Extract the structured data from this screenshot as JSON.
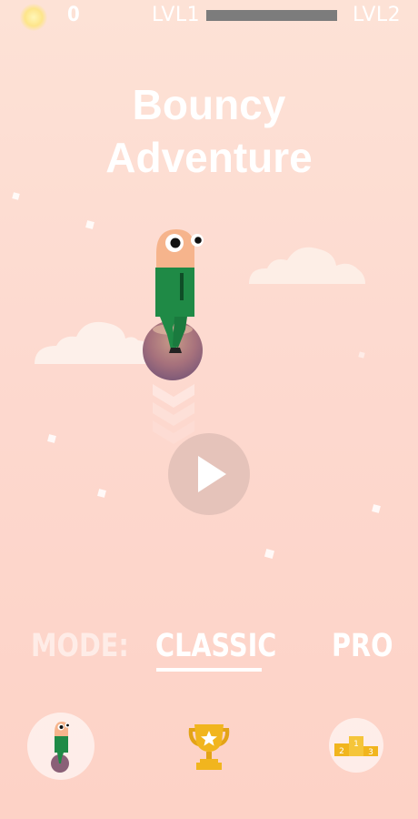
{
  "hud": {
    "score": "0",
    "level_from": "LVL1",
    "level_to": "LVL2",
    "level_progress": 0.0,
    "sun_icon": "sun-icon"
  },
  "title": {
    "line1": "Bouncy",
    "line2": "Adventure"
  },
  "play": {
    "icon": "play-icon"
  },
  "modes": {
    "label": "MODE:",
    "options": [
      "CLASSIC",
      "PRO"
    ],
    "selected": "CLASSIC"
  },
  "bottom_bar": {
    "items": [
      "character-select-icon",
      "trophy-icon",
      "leaderboard-podium-icon"
    ],
    "podium_places": [
      "2",
      "1",
      "3"
    ]
  },
  "colors": {
    "background_top": "#fde2d6",
    "background_bottom": "#fdd2c6",
    "progress_track": "#7c7c7c",
    "character_body": "#1f8a46",
    "character_head": "#f6b48c",
    "trophy": "#f1b51e"
  }
}
